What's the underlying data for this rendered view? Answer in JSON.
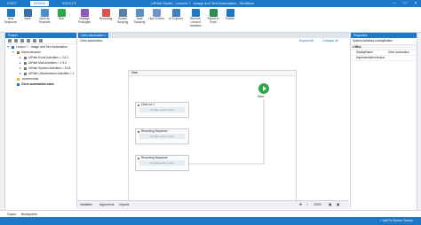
{
  "titlebar": {
    "tabs": [
      "START",
      "DESIGN",
      "EXECUTE"
    ],
    "title": "UiPath Studio - Lesson 7 - Image and Text Automation - Workflow"
  },
  "ribbon": {
    "buttons": [
      {
        "label": "New Sequence",
        "icon": "new-sequence-icon"
      },
      {
        "label": "Save",
        "icon": "save-icon"
      },
      {
        "label": "Save as Template",
        "icon": "template-icon"
      },
      {
        "label": "Run",
        "icon": "run-icon"
      },
      {
        "label": "Manage Packages",
        "icon": "packages-icon"
      },
      {
        "label": "Recording",
        "icon": "recording-icon"
      },
      {
        "label": "Screen Scraping",
        "icon": "scraping-icon"
      },
      {
        "label": "Data Scraping",
        "icon": "data-scraping-icon"
      },
      {
        "label": "User Events",
        "icon": "user-events-icon"
      },
      {
        "label": "UI Explorer",
        "icon": "ui-explorer-icon"
      },
      {
        "label": "Remove Unused Variables",
        "icon": "remove-variables-icon"
      },
      {
        "label": "Export to Excel",
        "icon": "excel-icon"
      },
      {
        "label": "Publish",
        "icon": "publish-icon"
      }
    ]
  },
  "project": {
    "title": "Project",
    "tree": [
      {
        "label": "Lesson 7 - Image and Text Automation",
        "depth": 0
      },
      {
        "label": "Dependencies",
        "depth": 1
      },
      {
        "label": "UiPath.Excel.Activities = 2.4.2",
        "depth": 2
      },
      {
        "label": "UiPath.Mail.Activities = 1.3.0",
        "depth": 2
      },
      {
        "label": "UiPath.System.Activities = 19.8.",
        "depth": 2
      },
      {
        "label": "UiPath.UIAutomation.Activities = 1",
        "depth": 2
      },
      {
        "label": ".screenshots",
        "depth": 1
      },
      {
        "label": "Citrix automation.xaml",
        "depth": 1
      }
    ]
  },
  "designer": {
    "doc_tab": "Citrix automation",
    "breadcrumb": "Citrix automation",
    "expand_all": "Expand All",
    "collapse_all": "Collapse All",
    "sequence_title": "Main",
    "start_label": "Start",
    "activities": [
      {
        "title": "Citrix rec 1",
        "body": "Double-click to view"
      },
      {
        "title": "Recording Sequence",
        "body": "Double-click to view"
      },
      {
        "title": "Recording Sequence",
        "body": "Double-click to view"
      }
    ],
    "bottom_tabs": [
      "Variables",
      "Arguments",
      "Imports"
    ],
    "zoom": "100%"
  },
  "properties": {
    "title": "Properties",
    "subtitle": "System.Activities.ActivityBuilder",
    "section": "Misc",
    "rows": [
      {
        "name": "DisplayName",
        "value": "Citrix automation"
      },
      {
        "name": "ImplementationVersion",
        "value": ""
      }
    ]
  },
  "bottom": {
    "tabs": [
      "Output",
      "Breakpoints"
    ],
    "status": "+ Add To Source Control"
  },
  "colors": {
    "accent": "#1e78c8",
    "start": "#2aa84a"
  }
}
